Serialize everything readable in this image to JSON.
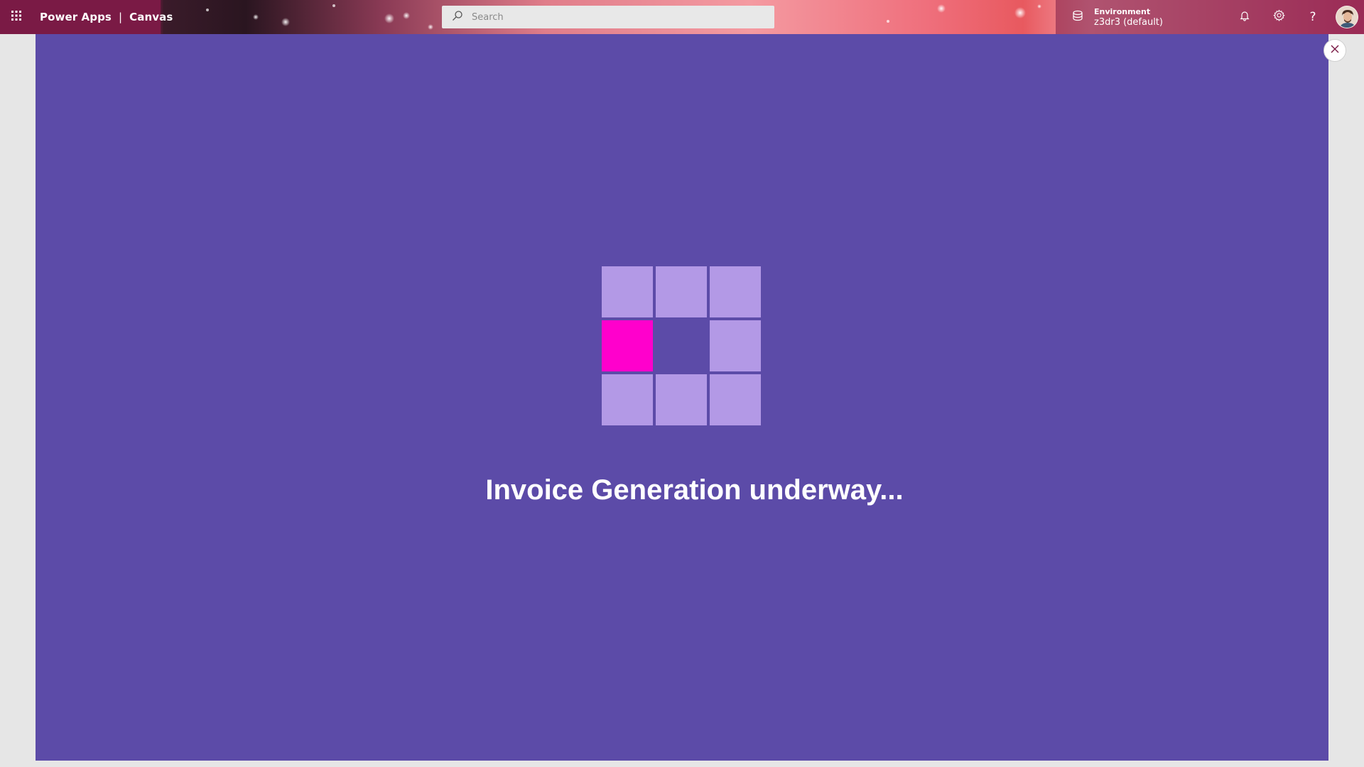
{
  "header": {
    "app_name": "Power Apps",
    "separator": "|",
    "app_type": "Canvas",
    "waffle_icon": "waffle-icon",
    "search": {
      "placeholder": "Search",
      "value": "",
      "icon": "search-icon"
    },
    "environment": {
      "label": "Environment",
      "name": "z3dr3 (default)",
      "icon": "environment-icon"
    },
    "actions": {
      "notifications_icon": "bell-icon",
      "settings_icon": "gear-icon",
      "help_icon": "help-icon",
      "help_glyph": "?"
    },
    "avatar": "user-avatar"
  },
  "loading_screen": {
    "message": "Invoice Generation underway...",
    "background_color": "#5c4ba8",
    "tile_color": "#b399e6",
    "active_tile_color": "#ff00cc",
    "close_icon": "close-icon"
  }
}
